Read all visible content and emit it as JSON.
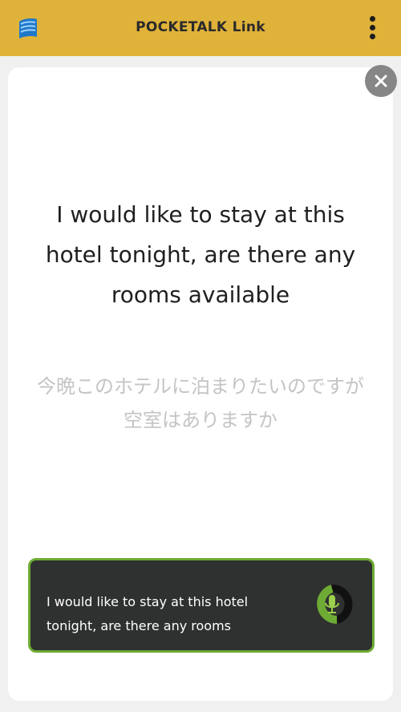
{
  "header": {
    "title": "POCKETALK Link",
    "logo_icon": "pocketalk-logo-icon",
    "menu_icon": "more-vertical-icon",
    "background_color": "#dfb23a"
  },
  "card": {
    "close_icon": "close-icon",
    "source_text": "I would like to stay at this hotel tonight, are there any rooms available",
    "translated_text": "今晩このホテルに泊まりたいのですが空室はありますか"
  },
  "transcript": {
    "text": "I would like to stay at this hotel tonight, are there any rooms",
    "mic_icon": "microphone-icon",
    "border_color": "#6eab34"
  }
}
